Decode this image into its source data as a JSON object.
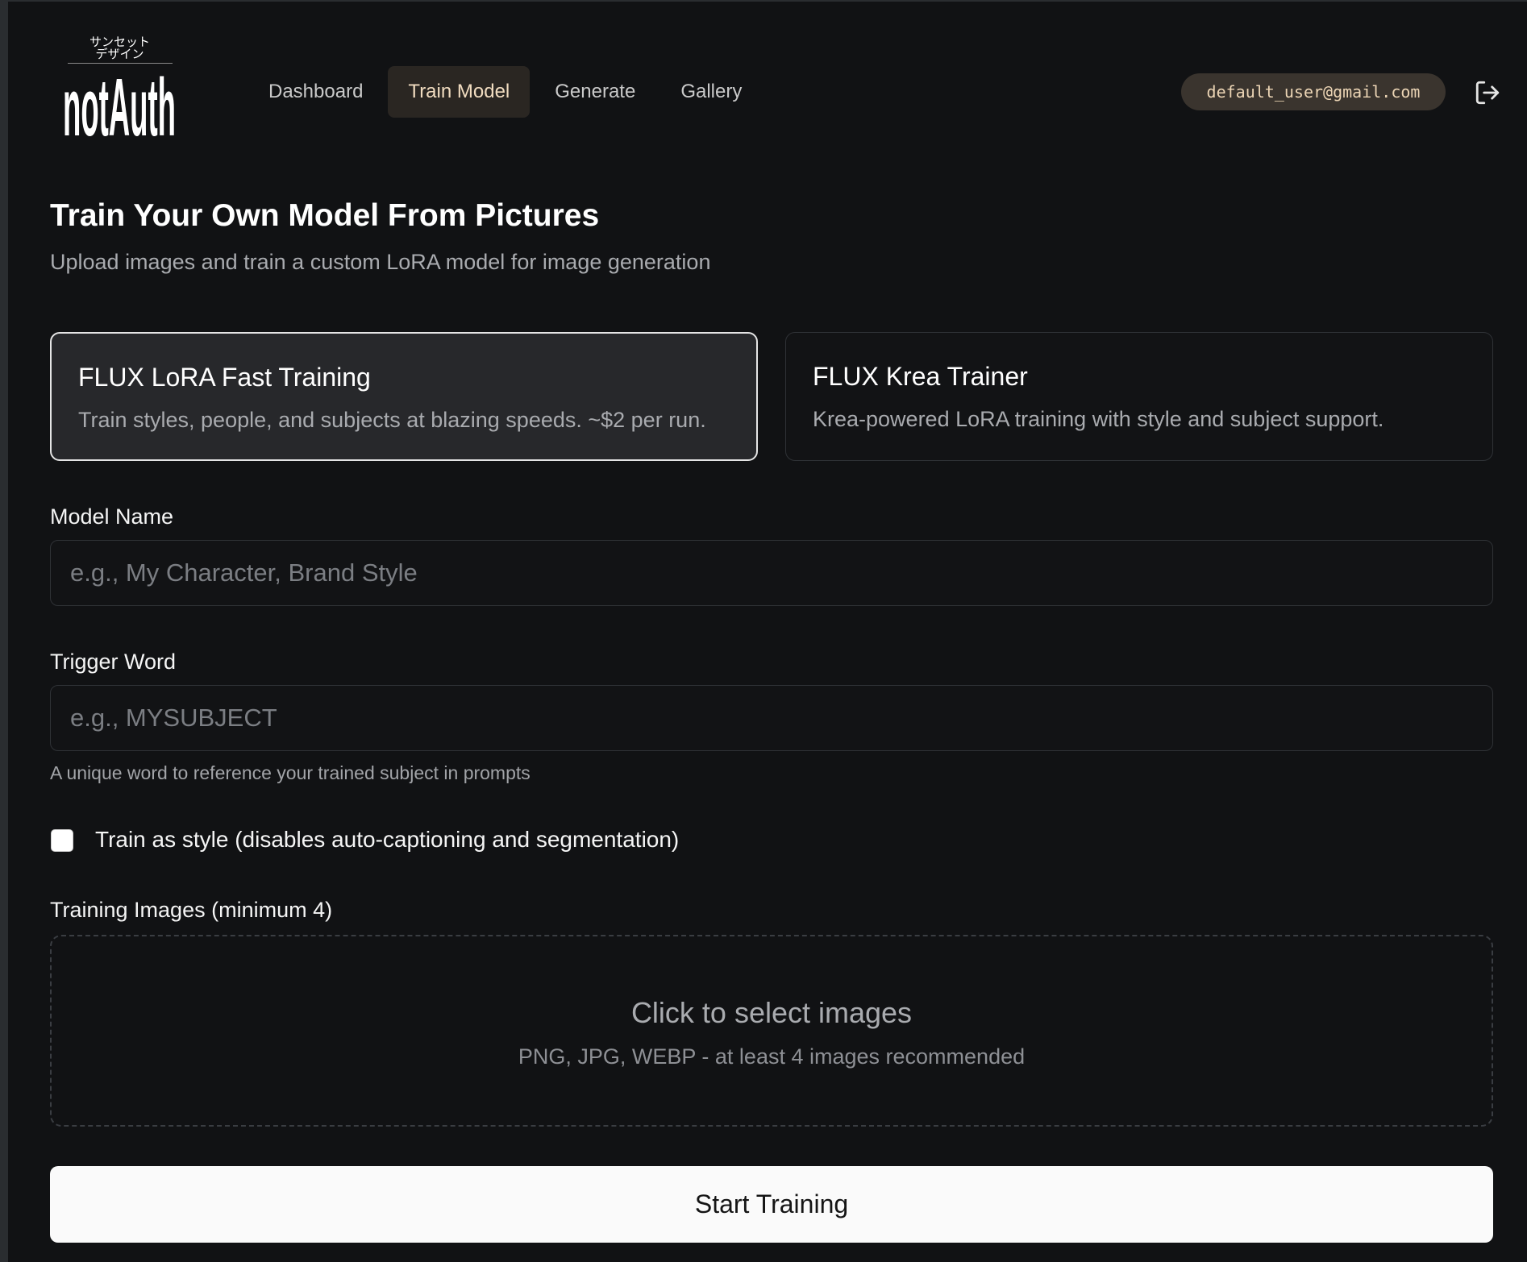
{
  "header": {
    "logo": {
      "jp_line1": "サンセット",
      "jp_line2": "デザイン",
      "wordmark": "notAuth"
    },
    "nav": [
      {
        "label": "Dashboard",
        "active": false
      },
      {
        "label": "Train Model",
        "active": true
      },
      {
        "label": "Generate",
        "active": false
      },
      {
        "label": "Gallery",
        "active": false
      }
    ],
    "user_email": "default_user@gmail.com",
    "logout_icon": "logout-icon"
  },
  "main": {
    "title": "Train Your Own Model From Pictures",
    "subtitle": "Upload images and train a custom LoRA model for image generation",
    "trainers": [
      {
        "title": "FLUX LoRA Fast Training",
        "description": "Train styles, people, and subjects at blazing speeds. ~$2 per run.",
        "selected": true
      },
      {
        "title": "FLUX Krea Trainer",
        "description": "Krea-powered LoRA training with style and subject support.",
        "selected": false
      }
    ],
    "model_name": {
      "label": "Model Name",
      "value": "",
      "placeholder": "e.g., My Character, Brand Style"
    },
    "trigger_word": {
      "label": "Trigger Word",
      "value": "",
      "placeholder": "e.g., MYSUBJECT",
      "hint": "A unique word to reference your trained subject in prompts"
    },
    "train_as_style": {
      "label": "Train as style (disables auto-captioning and segmentation)",
      "checked": false
    },
    "training_images": {
      "label": "Training Images (minimum 4)",
      "dropzone_title": "Click to select images",
      "dropzone_subtitle": "PNG, JPG, WEBP - at least 4 images recommended"
    },
    "start_button": "Start Training"
  },
  "colors": {
    "background": "#111214",
    "nav_active_bg": "#2a2622",
    "nav_active_text": "#f1dcc0",
    "email_pill_bg": "#3a342e",
    "primary_button_bg": "#fafafa"
  }
}
